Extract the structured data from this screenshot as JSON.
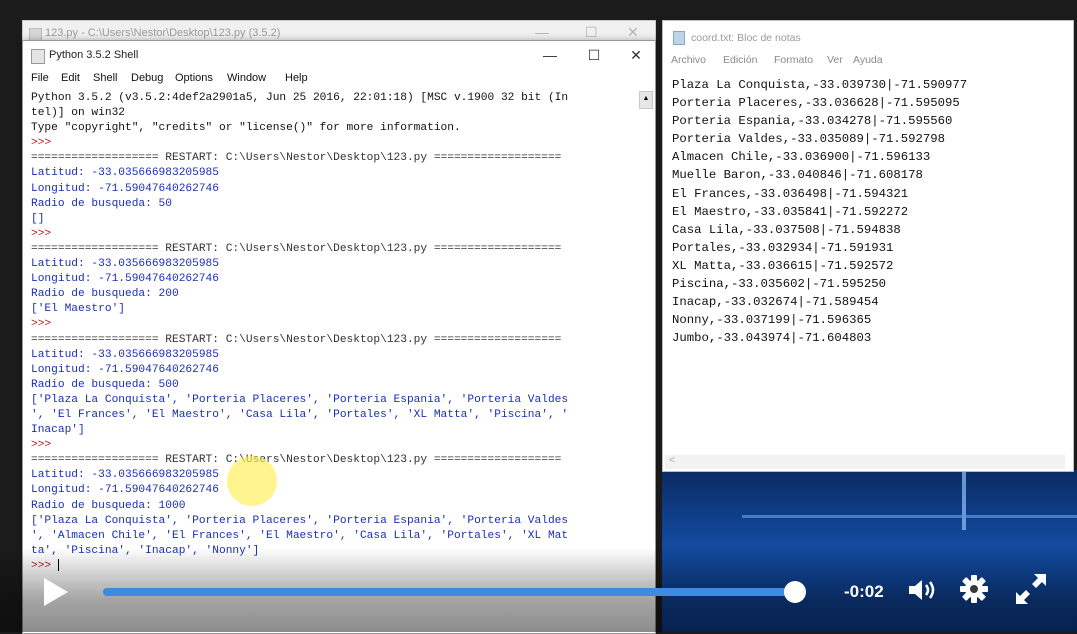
{
  "editor": {
    "title": "123.py - C:\\Users\\Nestor\\Desktop\\123.py (3.5.2)"
  },
  "shell": {
    "title": "Python 3.5.2 Shell",
    "controls": {
      "minimize": "—",
      "maximize": "☐",
      "close": "✕"
    },
    "menu": [
      "File",
      "Edit",
      "Shell",
      "Debug",
      "Options",
      "Window",
      "Help"
    ],
    "lines": [
      {
        "t": "Python 3.5.2 (v3.5.2:4def2a2901a5, Jun 25 2016, 22:01:18) [MSC v.1900 32 bit (In",
        "c": "black"
      },
      {
        "t": "tel)] on win32",
        "c": "black"
      },
      {
        "t": "Type \"copyright\", \"credits\" or \"license()\" for more information.",
        "c": "black"
      },
      {
        "t": ">>> ",
        "c": "red"
      },
      {
        "t": "=================== RESTART: C:\\Users\\Nestor\\Desktop\\123.py ===================",
        "c": "dark"
      },
      {
        "t": "Latitud: -33.035666983205985",
        "c": "blue"
      },
      {
        "t": "Longitud: -71.59047640262746",
        "c": "blue"
      },
      {
        "t": "Radio de busqueda: 50",
        "c": "blue"
      },
      {
        "t": "[]",
        "c": "blue"
      },
      {
        "t": ">>> ",
        "c": "red"
      },
      {
        "t": "=================== RESTART: C:\\Users\\Nestor\\Desktop\\123.py ===================",
        "c": "dark"
      },
      {
        "t": "Latitud: -33.035666983205985",
        "c": "blue"
      },
      {
        "t": "Longitud: -71.59047640262746",
        "c": "blue"
      },
      {
        "t": "Radio de busqueda: 200",
        "c": "blue"
      },
      {
        "t": "['El Maestro']",
        "c": "blue"
      },
      {
        "t": ">>> ",
        "c": "red"
      },
      {
        "t": "=================== RESTART: C:\\Users\\Nestor\\Desktop\\123.py ===================",
        "c": "dark"
      },
      {
        "t": "Latitud: -33.035666983205985",
        "c": "blue"
      },
      {
        "t": "Longitud: -71.59047640262746",
        "c": "blue"
      },
      {
        "t": "Radio de busqueda: 500",
        "c": "blue"
      },
      {
        "t": "['Plaza La Conquista', 'Porteria Placeres', 'Porteria Espania', 'Porteria Valdes",
        "c": "blue"
      },
      {
        "t": "', 'El Frances', 'El Maestro', 'Casa Lila', 'Portales', 'XL Matta', 'Piscina', '",
        "c": "blue"
      },
      {
        "t": "Inacap']",
        "c": "blue"
      },
      {
        "t": ">>> ",
        "c": "red"
      },
      {
        "t": "=================== RESTART: C:\\Users\\Nestor\\Desktop\\123.py ===================",
        "c": "dark"
      },
      {
        "t": "Latitud: -33.035666983205985",
        "c": "blue"
      },
      {
        "t": "Longitud: -71.59047640262746",
        "c": "blue"
      },
      {
        "t": "Radio de busqueda: 1000",
        "c": "blue"
      },
      {
        "t": "['Plaza La Conquista', 'Porteria Placeres', 'Porteria Espania', 'Porteria Valdes",
        "c": "blue"
      },
      {
        "t": "', 'Almacen Chile', 'El Frances', 'El Maestro', 'Casa Lila', 'Portales', 'XL Mat",
        "c": "blue"
      },
      {
        "t": "ta', 'Piscina', 'Inacap', 'Nonny']",
        "c": "blue"
      },
      {
        "t": ">>> ",
        "c": "red"
      }
    ]
  },
  "notepad": {
    "title": "coord.txt: Bloc de notas",
    "menu": [
      "Archivo",
      "Edición",
      "Formato",
      "Ver",
      "Ayuda"
    ],
    "lines": [
      "Plaza La Conquista,-33.039730|-71.590977",
      "Porteria Placeres,-33.036628|-71.595095",
      "Porteria Espania,-33.034278|-71.595560",
      "Porteria Valdes,-33.035089|-71.592798",
      "Almacen Chile,-33.036900|-71.596133",
      "Muelle Baron,-33.040846|-71.608178",
      "El Frances,-33.036498|-71.594321",
      "El Maestro,-33.035841|-71.592272",
      "Casa Lila,-33.037508|-71.594838",
      "Portales,-33.032934|-71.591931",
      "XL Matta,-33.036615|-71.592572",
      "Piscina,-33.035602|-71.595250",
      "Inacap,-33.032674|-71.589454",
      "Nonny,-33.037199|-71.596365",
      "Jumbo,-33.043974|-71.604803"
    ]
  },
  "player": {
    "time_remaining": "-0:02",
    "progress": 0.998,
    "icons": [
      "play-icon",
      "volume-icon",
      "settings-gear-icon",
      "fullscreen-icon"
    ]
  }
}
